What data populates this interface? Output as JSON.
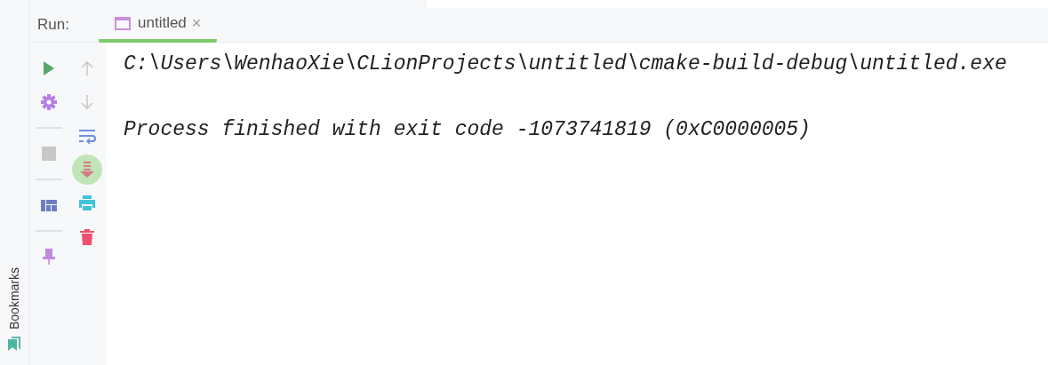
{
  "sidebar": {
    "label": "Bookmarks"
  },
  "run_panel": {
    "title": "Run:",
    "tabs": [
      {
        "label": "untitled",
        "selected": true,
        "close": "×"
      }
    ]
  },
  "toolbar_left": [
    {
      "kind": "run",
      "disabled": false
    },
    {
      "kind": "settings",
      "disabled": false
    },
    {
      "kind": "separator"
    },
    {
      "kind": "stop",
      "disabled": true
    },
    {
      "kind": "separator"
    },
    {
      "kind": "layout",
      "disabled": false
    },
    {
      "kind": "separator"
    },
    {
      "kind": "pin",
      "disabled": false
    }
  ],
  "toolbar_right": [
    {
      "kind": "up",
      "disabled": true,
      "on": false
    },
    {
      "kind": "down",
      "disabled": true,
      "on": false
    },
    {
      "kind": "wrap",
      "disabled": false,
      "on": false
    },
    {
      "kind": "scroll-end",
      "disabled": false,
      "on": true
    },
    {
      "kind": "print",
      "disabled": false,
      "on": false
    },
    {
      "kind": "trash",
      "disabled": false,
      "on": false
    }
  ],
  "console": {
    "lines": [
      "C:\\Users\\WenhaoXie\\CLionProjects\\untitled\\cmake-build-debug\\untitled.exe",
      "Process finished with exit code -1073741819 (0xC0000005)"
    ]
  }
}
